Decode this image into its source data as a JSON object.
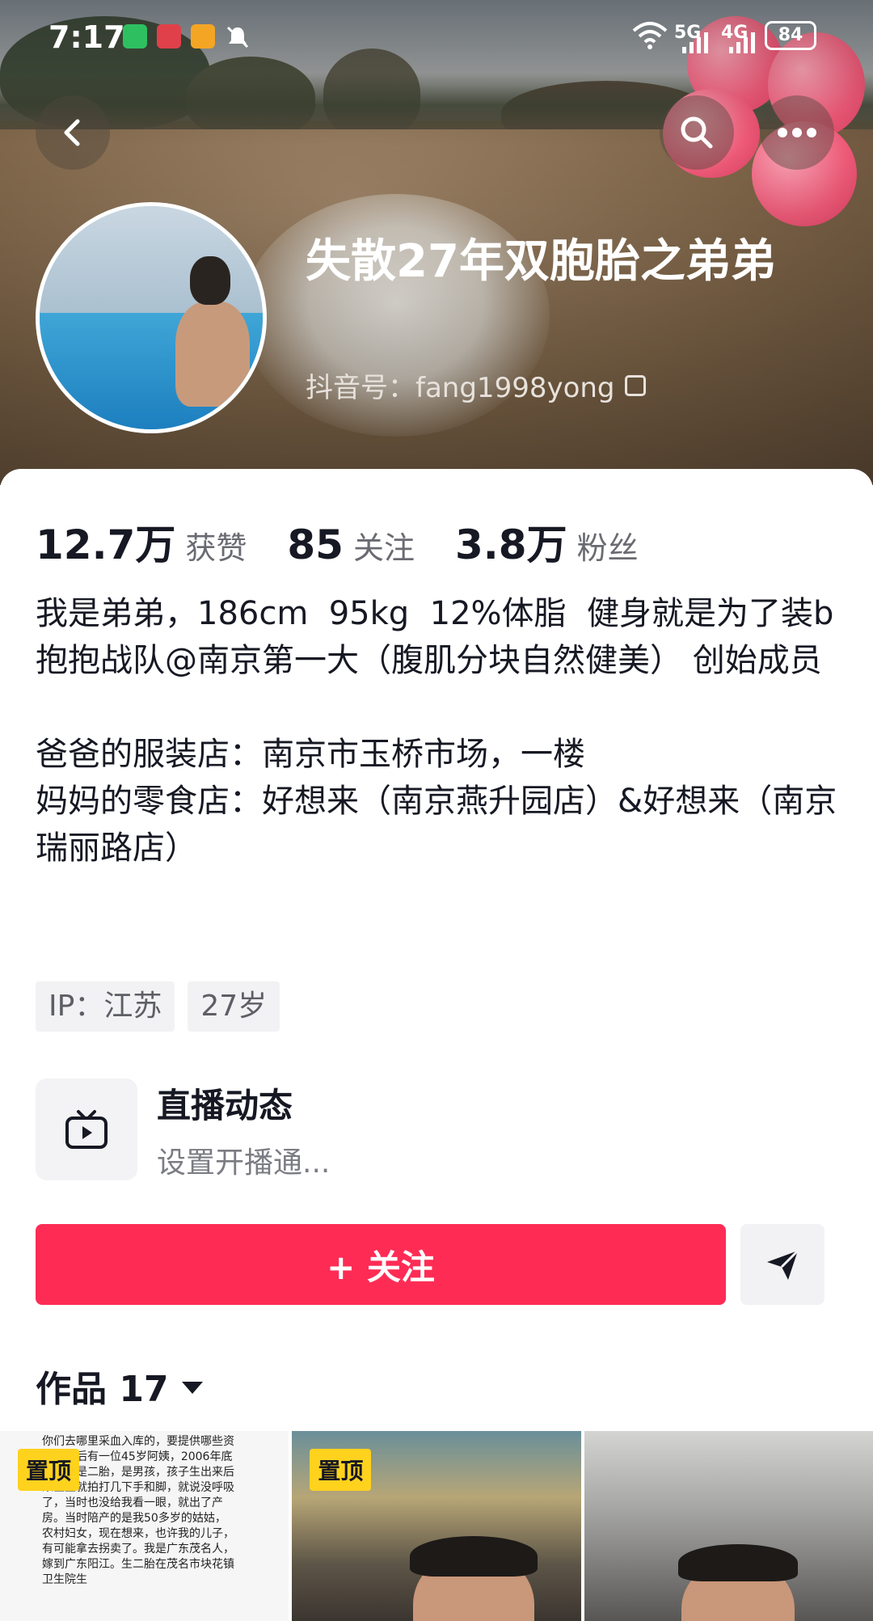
{
  "status_bar": {
    "time": "7:17",
    "network1": "5G",
    "network2": "4G",
    "battery": "84"
  },
  "profile": {
    "nickname": "失散27年双胞胎之弟弟",
    "douyin_id": "抖音号：fang1998yong"
  },
  "stats": {
    "likes_count": "12.7万",
    "likes_label": "获赞",
    "following_count": "85",
    "following_label": "关注",
    "followers_count": "3.8万",
    "followers_label": "粉丝"
  },
  "bio": "我是弟弟，186cm  95kg  12%体脂  健身就是为了装b\n抱抱战队@南京第一大（腹肌分块自然健美） 创始成员\n\n爸爸的服装店：南京市玉桥市场，一楼\n妈妈的零食店：好想来（南京燕升园店）&好想来（南京瑞丽路店）",
  "tags": [
    "IP：江苏",
    "27岁"
  ],
  "live": {
    "title": "直播动态",
    "subtitle": "设置开播通..."
  },
  "actions": {
    "follow_label": "+ 关注"
  },
  "works": {
    "label": "作品 17"
  },
  "thumbnails": [
    {
      "pin_label": "置顶",
      "caption": "你们去哪里采血入库的，要提供哪些资料？最后有一位45岁阿姨，2006年底她生的是二胎，是男孩，孩子生出来后来医生就拍打几下手和脚，就说没呼吸了，当时也没给我看一眼，就出了产房。当时陪产的是我50多岁的姑姑，农村妇女，现在想来，也许我的儿子，有可能拿去拐卖了。我是广东茂名人，嫁到广东阳江。生二胎在茂名市块花镇卫生院生"
    },
    {
      "pin_label": "置顶"
    },
    {}
  ],
  "colors": {
    "accent": "#fe2c55",
    "pin": "#ffd21e",
    "text": "#161823",
    "secondary": "#6a6b72"
  }
}
